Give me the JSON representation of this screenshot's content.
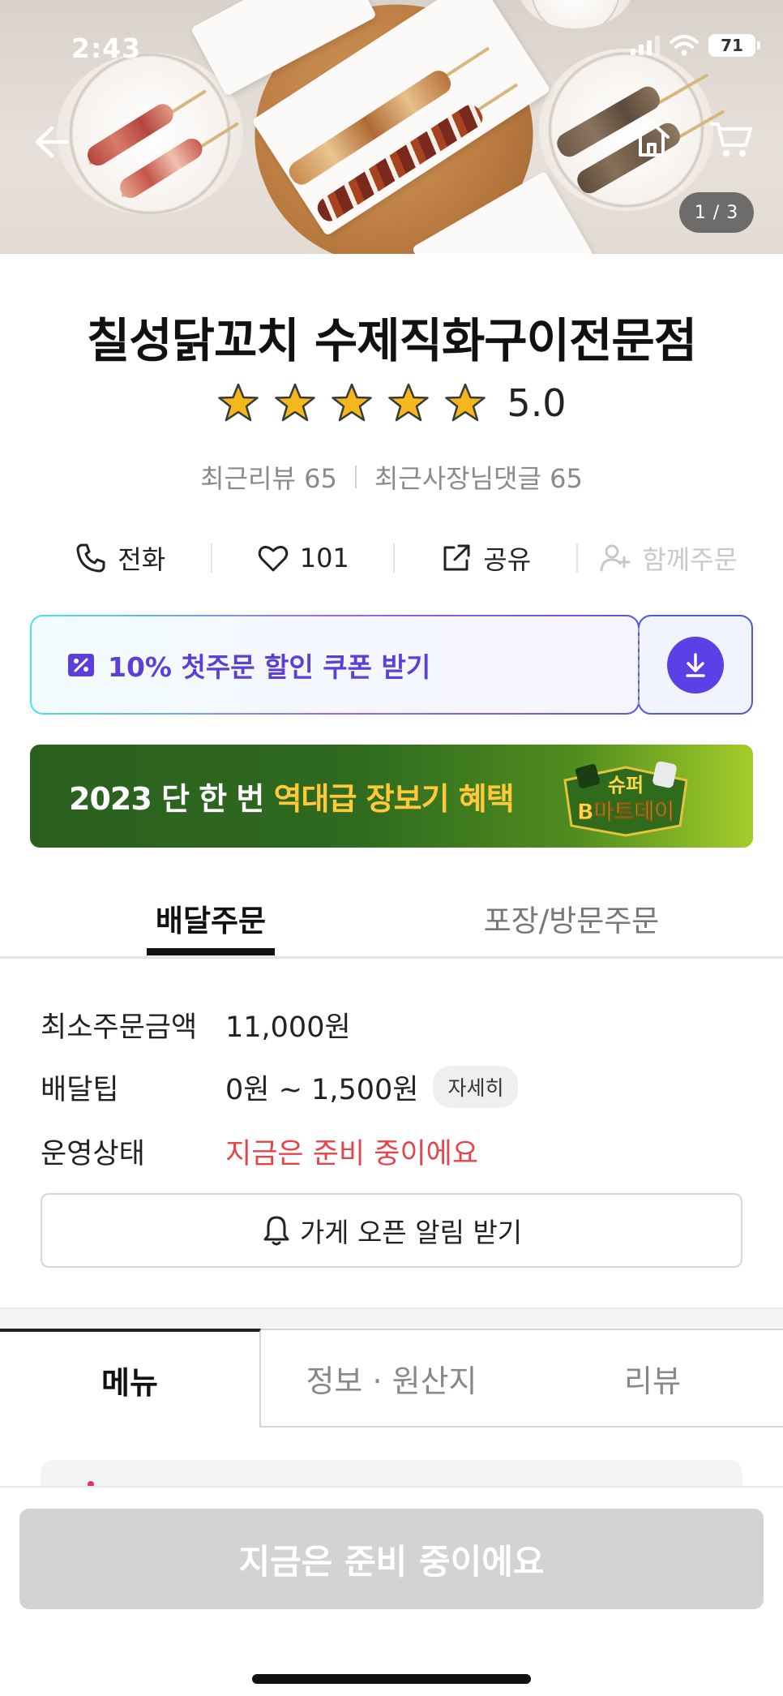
{
  "status_bar": {
    "time": "2:43",
    "battery": "71"
  },
  "hero": {
    "image_counter": "1 / 3"
  },
  "store": {
    "name": "칠성닭꼬치 수제직화구이전문점",
    "rating": "5.0",
    "stars": 5,
    "recent_reviews_label": "최근리뷰 65",
    "recent_owner_replies_label": "최근사장님댓글 65"
  },
  "actions": {
    "call": "전화",
    "likes": "101",
    "share": "공유",
    "group_order": "함께주문"
  },
  "coupon": {
    "text": "10% 첫주문 할인 쿠폰 받기"
  },
  "banner": {
    "text_part1": "2023 단 한 번 ",
    "text_highlight": "역대급 장보기 혜택",
    "logo_line1": "슈퍼",
    "logo_line2": "B마트데이"
  },
  "order_tabs": {
    "delivery": "배달주문",
    "pickup": "포장/방문주문"
  },
  "info": {
    "min_order_label": "최소주문금액",
    "min_order_value": "11,000원",
    "delivery_tip_label": "배달팁",
    "delivery_tip_value": "0원 ~ 1,500원",
    "detail_chip": "자세히",
    "status_label": "운영상태",
    "status_value": "지금은 준비 중이에요"
  },
  "alarm_button": "가게 오픈 알림 받기",
  "section_tabs": {
    "menu": "메뉴",
    "info": "정보 · 원산지",
    "review": "리뷰"
  },
  "bottom_button": "지금은 준비 중이에요",
  "colors": {
    "accent_purple": "#5d3fe6",
    "status_red": "#e5454a",
    "banner_green": "#2f6a1f",
    "banner_highlight": "#ffc93a",
    "star_yellow": "#f5b81c"
  }
}
